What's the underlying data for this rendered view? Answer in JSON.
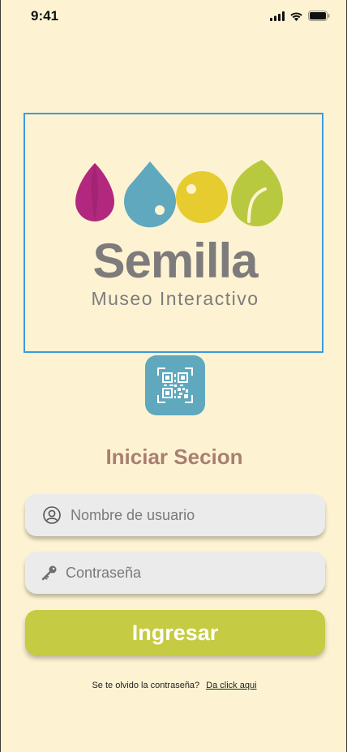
{
  "status_bar": {
    "time": "9:41"
  },
  "logo": {
    "brand": "Semilla",
    "tagline": "Museo Interactivo"
  },
  "login": {
    "title": "Iniciar Secion",
    "username_placeholder": "Nombre de usuario",
    "password_placeholder": "Contraseña",
    "submit_label": "Ingresar",
    "forgot_text": "Se te olvido la contraseña?",
    "forgot_link": "Da click aqui"
  },
  "colors": {
    "background": "#fdf3d2",
    "title": "#a97f71",
    "submit": "#c5cb42",
    "qr_button": "#5fa8be",
    "logo_magenta": "#b3287f",
    "logo_blue": "#5fa8be",
    "logo_yellow": "#e6cc2e",
    "logo_green": "#b9c93f"
  },
  "icons": [
    "signal-icon",
    "wifi-icon",
    "battery-icon",
    "qr-code-icon",
    "user-icon",
    "key-icon"
  ]
}
